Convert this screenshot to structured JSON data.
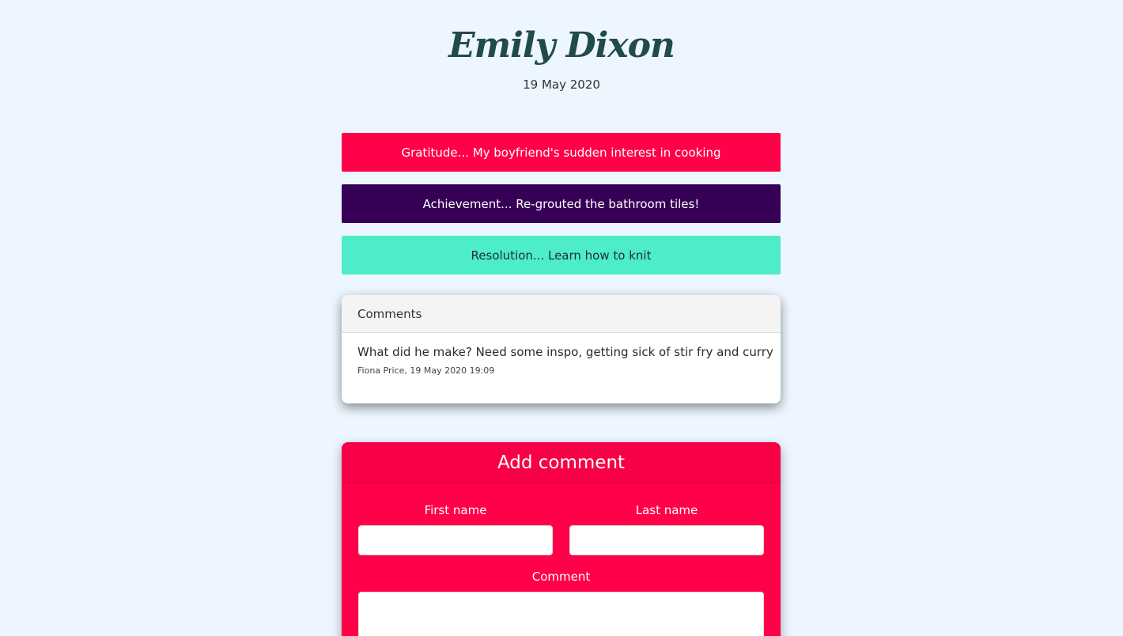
{
  "profile": {
    "name": "Emily Dixon",
    "date": "19 May 2020"
  },
  "entries": [
    {
      "label": "Gratitude... My boyfriend's sudden interest in cooking",
      "color": "#ff0049"
    },
    {
      "label": "Achievement... Re-grouted the bathroom tiles!",
      "color": "#370057"
    },
    {
      "label": "Resolution... Learn how to knit",
      "color": "#4dedca"
    }
  ],
  "comments": {
    "title": "Comments",
    "items": [
      {
        "text": "What did he make? Need some inspo, getting sick of stir fry and curry",
        "meta": "Fiona Price, 19 May 2020 19:09"
      }
    ]
  },
  "add_comment": {
    "title": "Add comment",
    "first_name_label": "First name",
    "first_name_value": "",
    "last_name_label": "Last name",
    "last_name_value": "",
    "comment_label": "Comment",
    "comment_value": ""
  }
}
